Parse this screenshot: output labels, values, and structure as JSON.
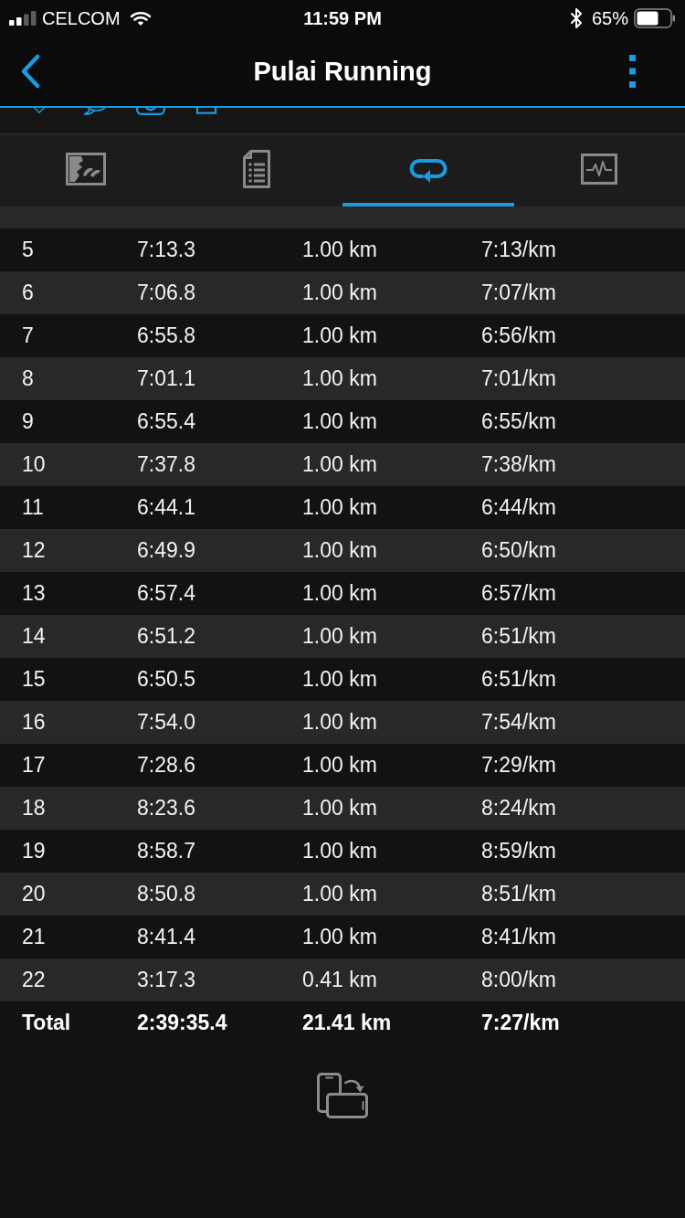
{
  "status_bar": {
    "carrier": "CELCOM",
    "time": "11:59 PM",
    "battery": "65%"
  },
  "nav": {
    "title": "Pulai Running"
  },
  "tabs": [
    {
      "kind": "map",
      "selected": false
    },
    {
      "kind": "document",
      "selected": false
    },
    {
      "kind": "laps",
      "selected": true
    },
    {
      "kind": "chart",
      "selected": false
    }
  ],
  "laps_table": {
    "rows": [
      [
        "5",
        "7:13.3",
        "1.00 km",
        "7:13/km"
      ],
      [
        "6",
        "7:06.8",
        "1.00 km",
        "7:07/km"
      ],
      [
        "7",
        "6:55.8",
        "1.00 km",
        "6:56/km"
      ],
      [
        "8",
        "7:01.1",
        "1.00 km",
        "7:01/km"
      ],
      [
        "9",
        "6:55.4",
        "1.00 km",
        "6:55/km"
      ],
      [
        "10",
        "7:37.8",
        "1.00 km",
        "7:38/km"
      ],
      [
        "11",
        "6:44.1",
        "1.00 km",
        "6:44/km"
      ],
      [
        "12",
        "6:49.9",
        "1.00 km",
        "6:50/km"
      ],
      [
        "13",
        "6:57.4",
        "1.00 km",
        "6:57/km"
      ],
      [
        "14",
        "6:51.2",
        "1.00 km",
        "6:51/km"
      ],
      [
        "15",
        "6:50.5",
        "1.00 km",
        "6:51/km"
      ],
      [
        "16",
        "7:54.0",
        "1.00 km",
        "7:54/km"
      ],
      [
        "17",
        "7:28.6",
        "1.00 km",
        "7:29/km"
      ],
      [
        "18",
        "8:23.6",
        "1.00 km",
        "8:24/km"
      ],
      [
        "19",
        "8:58.7",
        "1.00 km",
        "8:59/km"
      ],
      [
        "20",
        "8:50.8",
        "1.00 km",
        "8:51/km"
      ],
      [
        "21",
        "8:41.4",
        "1.00 km",
        "8:41/km"
      ],
      [
        "22",
        "3:17.3",
        "0.41 km",
        "8:00/km"
      ]
    ],
    "total": [
      "Total",
      "2:39:35.4",
      "21.41 km",
      "7:27/km"
    ]
  }
}
